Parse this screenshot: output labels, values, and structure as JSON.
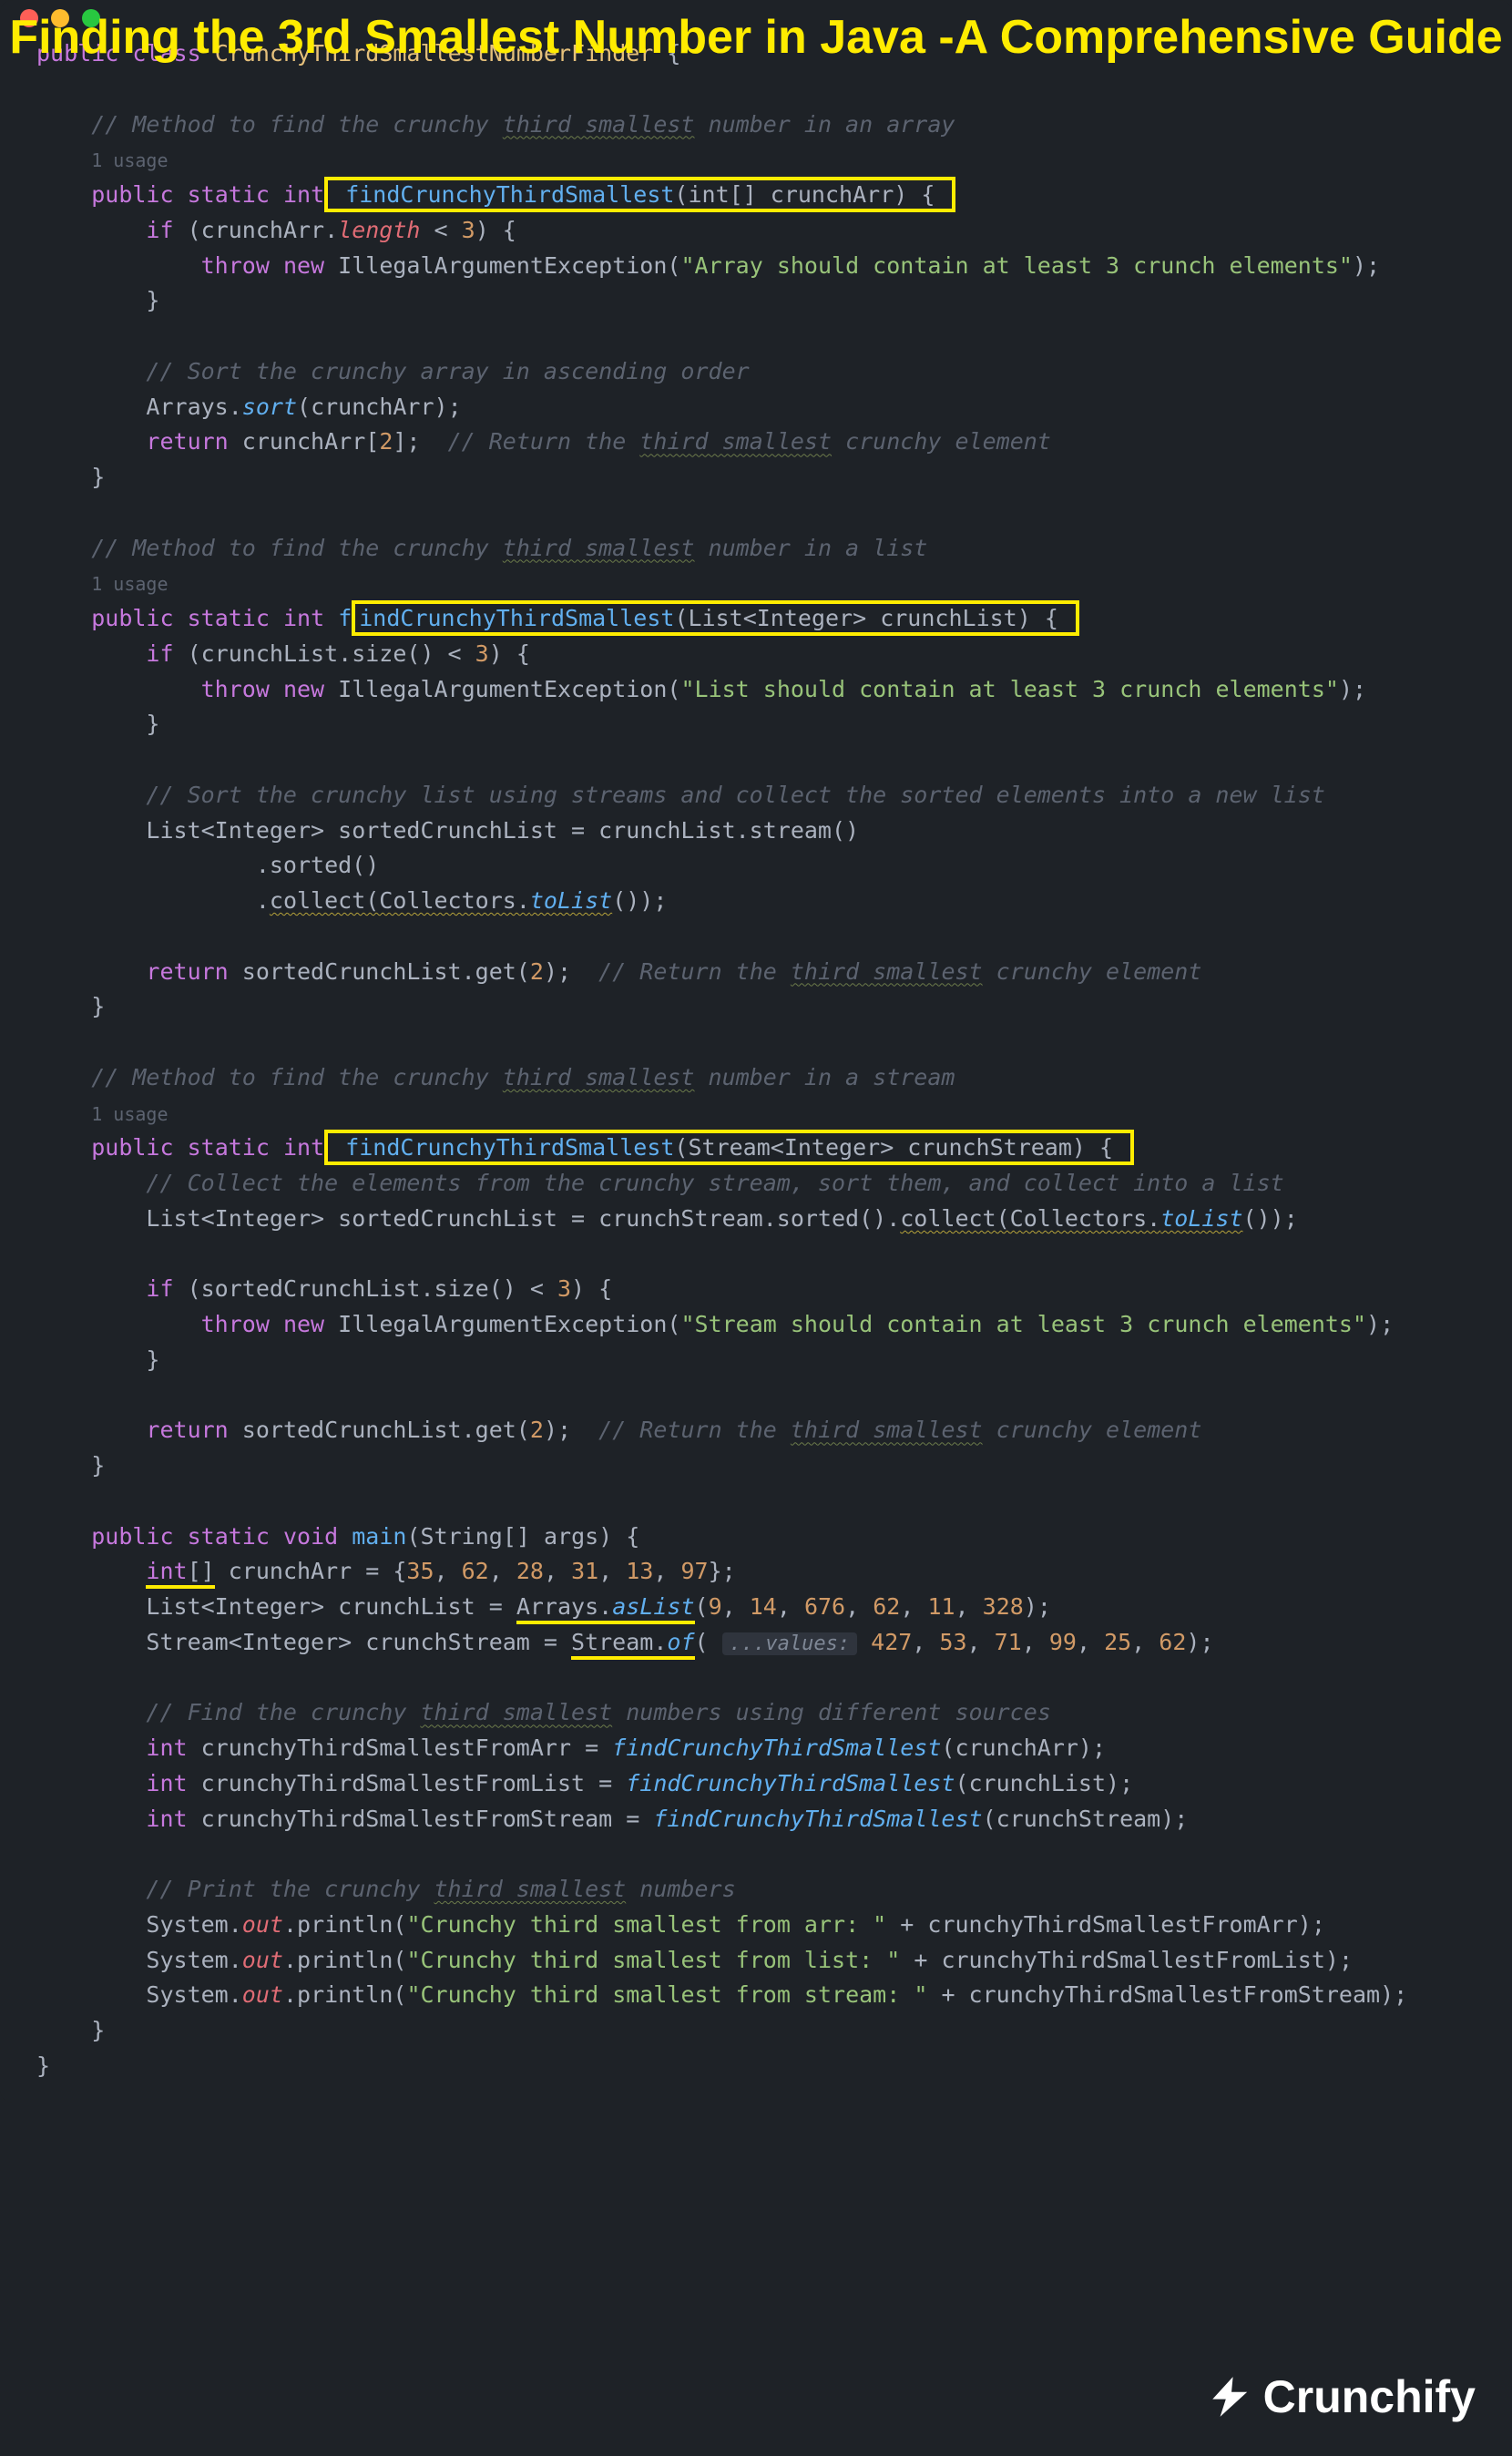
{
  "headline": "Finding the 3rd Smallest Number in Java -A Comprehensive Guide",
  "brand": "Crunchify",
  "class_decl": {
    "public": "public",
    "class": "class",
    "name": "CrunchyThirdSmallestNumberFinder",
    "open": "{"
  },
  "usage_label": "1 usage",
  "m1": {
    "comment": "// Method to find the crunchy ",
    "comment_wavy": "third smallest",
    "comment_tail": " number in an array",
    "public": "public",
    "static": "static",
    "ret": "int",
    "name": "findCrunchyThirdSmallest",
    "sig_params": "(int[] crunchArr) {",
    "if": "if",
    "cond_open": " (crunchArr.",
    "len": "length",
    "lt": " < ",
    "three": "3",
    "cond_close": ") {",
    "throw": "throw",
    "new": "new",
    "exc": "IllegalArgumentException",
    "msg": "\"Array should contain at least 3 crunch elements\"",
    "close_throw": ");",
    "close_if": "}",
    "cmt2": "// Sort the crunchy array in ascending order",
    "arrays": "Arrays",
    "sort": "sort",
    "sort_args": "(crunchArr);",
    "return": "return",
    "ret_expr": " crunchArr[",
    "idx": "2",
    "ret_tail": "];",
    "ret_cmt": "// Return the ",
    "ret_cmt_wavy": "third smallest",
    "ret_cmt_tail": " crunchy element",
    "close_m": "}"
  },
  "m2": {
    "comment": "// Method to find the crunchy ",
    "comment_wavy": "third smallest",
    "comment_tail": " number in a list",
    "public": "public",
    "static": "static",
    "ret": "int",
    "name_pre": "f",
    "name": "indCrunchyThirdSmallest",
    "sig_params": "(List<Integer> crunchList) {",
    "if": "if",
    "cond_open": " (crunchList.size() < ",
    "three": "3",
    "cond_close": ") {",
    "throw": "throw",
    "new": "new",
    "exc": "IllegalArgumentException",
    "msg": "\"List should contain at least 3 crunch elements\"",
    "close_throw": ");",
    "close_if": "}",
    "cmt2": "// Sort the crunchy list using streams and collect the sorted elements into a new list",
    "decl": "List<Integer> sortedCrunchList = crunchList.stream()",
    "sorted": ".sorted()",
    "collect1": ".",
    "collect_w": "collect(Collectors.",
    "tolist_w": "toList",
    "collect_tail": "());",
    "return": "return",
    "ret_expr": " sortedCrunchList.get(",
    "idx": "2",
    "ret_tail": ");",
    "ret_cmt": "// Return the ",
    "ret_cmt_wavy": "third smallest",
    "ret_cmt_tail": " crunchy element",
    "close_m": "}"
  },
  "m3": {
    "comment": "// Method to find the crunchy ",
    "comment_wavy": "third smallest",
    "comment_tail": " number in a stream",
    "public": "public",
    "static": "static",
    "ret": "int",
    "name": "findCrunchyThirdSmallest",
    "sig_params": "(Stream<Integer> crunchStream) {",
    "cmt1": "// Collect the elements from the crunchy stream, sort them, and collect into a list",
    "decl_a": "List<Integer> sortedCrunchList = crunchStream.sorted().",
    "decl_w": "collect(Collectors.",
    "decl_tl": "toList",
    "decl_tail": "());",
    "if": "if",
    "cond_open": " (sortedCrunchList.size() < ",
    "three": "3",
    "cond_close": ") {",
    "throw": "throw",
    "new": "new",
    "exc": "IllegalArgumentException",
    "msg": "\"Stream should contain at least 3 crunch elements\"",
    "close_throw": ");",
    "close_if": "}",
    "return": "return",
    "ret_expr": " sortedCrunchList.get(",
    "idx": "2",
    "ret_tail": ");",
    "ret_cmt": "// Return the ",
    "ret_cmt_wavy": "third smallest",
    "ret_cmt_tail": " crunchy element",
    "close_m": "}"
  },
  "main": {
    "public": "public",
    "static": "static",
    "void": "void",
    "name": "main",
    "params": "(String[] args) {",
    "arr_t": "int",
    "arr_br": "[]",
    "arr_decl": " crunchArr = {",
    "n1": "35",
    "n2": "62",
    "n3": "28",
    "n4": "31",
    "n5": "13",
    "n6": "97",
    "arr_close": "};",
    "list_decl_a": "List<Integer> crunchList = ",
    "arrays_u": "Arrays",
    "aslist": "asList",
    "lp": "(",
    "l1": "9",
    "l2": "14",
    "l3": "676",
    "l4": "62",
    "l5": "11",
    "l6": "328",
    "rp": ");",
    "stream_decl_a": "Stream<Integer> crunchStream = ",
    "stream_u": "Stream",
    "of": "of",
    "hint": "...values:",
    "s1": "427",
    "s2": "53",
    "s3": "71",
    "s4": "99",
    "s5": "25",
    "s6": "62",
    "cmtF": "// Find the crunchy ",
    "cmtF_w": "third smallest",
    "cmtF_t": " numbers using different sources",
    "int": "int",
    "v1": " crunchyThirdSmallestFromArr = ",
    "call1": "findCrunchyThirdSmallest",
    "a1": "(crunchArr);",
    "v2": " crunchyThirdSmallestFromList = ",
    "a2": "(crunchList);",
    "v3": " crunchyThirdSmallestFromStream = ",
    "a3": "(crunchStream);",
    "cmtP": "// Print the crunchy ",
    "cmtP_w": "third smallest",
    "cmtP_t": " numbers",
    "sys": "System",
    "out": "out",
    "println": "println",
    "p1": "\"Crunchy third smallest from arr: \"",
    "pv1": " + crunchyThirdSmallestFromArr);",
    "p2": "\"Crunchy third smallest from list: \"",
    "pv2": " + crunchyThirdSmallestFromList);",
    "p3": "\"Crunchy third smallest from stream: \"",
    "pv3": " + crunchyThirdSmallestFromStream);",
    "close_m": "}"
  },
  "close_class": "}"
}
